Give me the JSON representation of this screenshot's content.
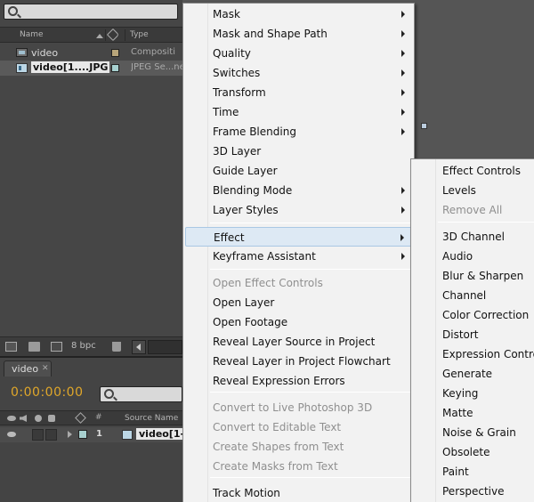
{
  "project": {
    "search_placeholder": "",
    "columns": {
      "name": "Name",
      "type": "Type"
    },
    "items": [
      {
        "name": "video",
        "type": "Compositi"
      },
      {
        "name": "video[1....JPG",
        "type": "JPEG Se...ne"
      }
    ],
    "bpc": "8 bpc"
  },
  "timeline": {
    "tab": "video",
    "tab_close": "✕",
    "timecode": "0:00:00:00",
    "columns": {
      "num": "#",
      "source_name": "Source Name"
    },
    "layer": {
      "num": "1",
      "name": "video[1-"
    }
  },
  "main_menu": {
    "items": [
      {
        "label": "Mask",
        "submenu": true,
        "disabled": false
      },
      {
        "label": "Mask and Shape Path",
        "submenu": true,
        "disabled": false
      },
      {
        "label": "Quality",
        "submenu": true,
        "disabled": false
      },
      {
        "label": "Switches",
        "submenu": true,
        "disabled": false
      },
      {
        "label": "Transform",
        "submenu": true,
        "disabled": false
      },
      {
        "label": "Time",
        "submenu": true,
        "disabled": false
      },
      {
        "label": "Frame Blending",
        "submenu": true,
        "disabled": false
      },
      {
        "label": "3D Layer",
        "submenu": false,
        "disabled": false
      },
      {
        "label": "Guide Layer",
        "submenu": false,
        "disabled": false
      },
      {
        "label": "Blending Mode",
        "submenu": true,
        "disabled": false
      },
      {
        "label": "Layer Styles",
        "submenu": true,
        "disabled": false
      },
      {
        "label": "Effect",
        "submenu": true,
        "disabled": false,
        "highlight": true
      },
      {
        "label": "Keyframe Assistant",
        "submenu": true,
        "disabled": false
      },
      {
        "label": "Open Effect Controls",
        "submenu": false,
        "disabled": true
      },
      {
        "label": "Open Layer",
        "submenu": false,
        "disabled": false
      },
      {
        "label": "Open Footage",
        "submenu": false,
        "disabled": false
      },
      {
        "label": "Reveal Layer Source in Project",
        "submenu": false,
        "disabled": false
      },
      {
        "label": "Reveal Layer in Project Flowchart",
        "submenu": false,
        "disabled": false
      },
      {
        "label": "Reveal Expression Errors",
        "submenu": false,
        "disabled": false
      },
      {
        "label": "Convert to Live Photoshop 3D",
        "submenu": false,
        "disabled": true
      },
      {
        "label": "Convert to Editable Text",
        "submenu": false,
        "disabled": true
      },
      {
        "label": "Create Shapes from Text",
        "submenu": false,
        "disabled": true
      },
      {
        "label": "Create Masks from Text",
        "submenu": false,
        "disabled": true
      },
      {
        "label": "Track Motion",
        "submenu": false,
        "disabled": false
      }
    ]
  },
  "effect_menu": {
    "items": [
      {
        "label": "Effect Controls",
        "disabled": false
      },
      {
        "label": "Levels",
        "disabled": false
      },
      {
        "label": "Remove All",
        "disabled": true
      },
      {
        "label": "3D Channel",
        "disabled": false
      },
      {
        "label": "Audio",
        "disabled": false
      },
      {
        "label": "Blur & Sharpen",
        "disabled": false
      },
      {
        "label": "Channel",
        "disabled": false
      },
      {
        "label": "Color Correction",
        "disabled": false
      },
      {
        "label": "Distort",
        "disabled": false
      },
      {
        "label": "Expression Controls",
        "disabled": false
      },
      {
        "label": "Generate",
        "disabled": false
      },
      {
        "label": "Keying",
        "disabled": false
      },
      {
        "label": "Matte",
        "disabled": false
      },
      {
        "label": "Noise & Grain",
        "disabled": false
      },
      {
        "label": "Obsolete",
        "disabled": false
      },
      {
        "label": "Paint",
        "disabled": false
      },
      {
        "label": "Perspective",
        "disabled": false
      }
    ]
  },
  "colors": {
    "timecode": "#e0a72a",
    "menu_bg": "#f2f2f2",
    "menu_highlight": "#dde9f4",
    "comp_label": "#b8a57a",
    "footage_label": "#a7d0cf"
  },
  "icons": {
    "search": "search-icon",
    "composition": "composition-icon",
    "footage": "footage-icon",
    "folder": "folder-icon",
    "trash": "trash-icon",
    "eye": "eye-icon",
    "lock": "lock-icon",
    "submenu": "chevron-right-icon"
  }
}
